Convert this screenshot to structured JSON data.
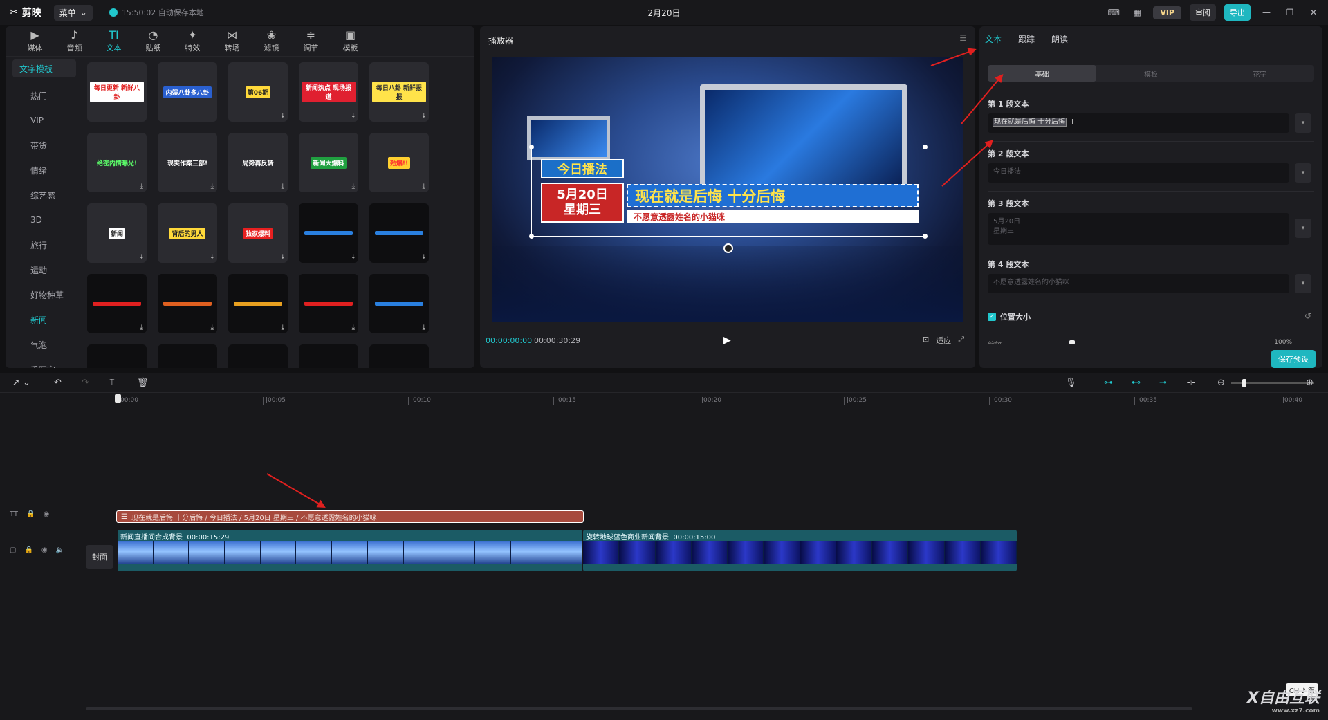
{
  "app": {
    "name": "剪映",
    "menu_label": "菜单",
    "save_status": "15:50:02 自动保存本地",
    "project_title": "2月20日"
  },
  "titlebar": {
    "vip": "VIP",
    "review": "审阅",
    "export": "导出"
  },
  "toolbar": [
    "媒体",
    "音频",
    "文本",
    "贴纸",
    "特效",
    "转场",
    "滤镜",
    "调节",
    "模板"
  ],
  "toolbar_icons": [
    "▶",
    "♪",
    "TI",
    "◔",
    "✦",
    "⋈",
    "❀",
    "≑",
    "▣"
  ],
  "categories": [
    "文字模板",
    "热门",
    "VIP",
    "带货",
    "情绪",
    "综艺感",
    "3D",
    "旅行",
    "运动",
    "好物种草",
    "新闻",
    "气泡",
    "手写字"
  ],
  "tiles": [
    {
      "t": "每日更新 新鲜八卦",
      "c": "#e02020",
      "bg": "#fff"
    },
    {
      "t": "内娱八卦多八卦",
      "c": "#fff",
      "bg": "#2a60d0"
    },
    {
      "t": "第06期",
      "c": "#222",
      "bg": "#ffd93a"
    },
    {
      "t": "新闻热点 现场报道",
      "c": "#fff",
      "bg": "#e02030"
    },
    {
      "t": "每日八卦 新鲜报报",
      "c": "#333",
      "bg": "#ffe34a"
    },
    {
      "t": "绝密内情曝光!",
      "c": "#5cff6a",
      "bg": "transparent"
    },
    {
      "t": "现实作案三部!",
      "c": "#fff",
      "bg": "transparent"
    },
    {
      "t": "局势再反转",
      "c": "#fff",
      "bg": "transparent"
    },
    {
      "t": "新闻大爆料",
      "c": "#fff",
      "bg": "#20a040"
    },
    {
      "t": "劲爆!!",
      "c": "#ff3030",
      "bg": "#ffd030"
    },
    {
      "t": "新闻",
      "c": "#333",
      "bg": "#fff"
    },
    {
      "t": "背后的男人",
      "c": "#222",
      "bg": "#ffd93a"
    },
    {
      "t": "独家爆料",
      "c": "#fff",
      "bg": "#e82020"
    },
    {
      "t": "",
      "c": "#fff",
      "bg": "#2a80e0"
    },
    {
      "t": "",
      "c": "#fff",
      "bg": "#2a80e0"
    },
    {
      "t": "",
      "c": "#fff",
      "bg": "#e02020"
    },
    {
      "t": "",
      "c": "#fff",
      "bg": "#e06020"
    },
    {
      "t": "",
      "c": "#fff",
      "bg": "#e8a020"
    },
    {
      "t": "",
      "c": "#fff",
      "bg": "#e02020"
    },
    {
      "t": "",
      "c": "#fff",
      "bg": "#2a80e0"
    },
    {
      "t": "",
      "c": "#fff",
      "bg": "#1a4ad0"
    },
    {
      "t": "",
      "c": "#fff",
      "bg": "#2a6ae0"
    },
    {
      "t": "",
      "c": "#222",
      "bg": "#ffd93a"
    },
    {
      "t": "",
      "c": "#fff",
      "bg": "#20a0a0"
    },
    {
      "t": "",
      "c": "#222",
      "bg": "#fff"
    }
  ],
  "player": {
    "title": "播放器",
    "tag": "今日播法",
    "date1": "5月20日",
    "date2": "星期三",
    "headline": "现在就是后悔 十分后悔",
    "subline": "不愿意透露姓名的小猫咪",
    "timecode": "00:00:00:00",
    "duration": "00:00:30:29",
    "ratio": "适应"
  },
  "right": {
    "tabs": [
      "文本",
      "跟踪",
      "朗读"
    ],
    "segments": [
      "基础",
      "模板",
      "花字"
    ],
    "fields": [
      {
        "label": "第 1 段文本",
        "value": "现在就是后悔 十分后悔"
      },
      {
        "label": "第 2 段文本",
        "value": "今日播法"
      },
      {
        "label": "第 3 段文本",
        "value": "5月20日",
        "value2": "星期三"
      },
      {
        "label": "第 4 段文本",
        "value": "不愿意透露姓名的小猫咪"
      }
    ],
    "position_size": "位置大小",
    "scale_label": "缩放",
    "scale_value": "100%",
    "save_preset": "保存预设"
  },
  "timeline": {
    "ticks": [
      "00:00",
      "|00:05",
      "|00:10",
      "|00:15",
      "|00:20",
      "|00:25",
      "|00:30",
      "|00:35",
      "|00:40"
    ],
    "text_clip": "现在就是后悔 十分后悔 / 今日播法 / 5月20日 星期三 / 不愿意透露姓名的小猫咪",
    "cover": "封面",
    "clip1_name": "新闻直播间合成背景",
    "clip1_dur": "00:00:15:29",
    "clip2_name": "旋转地球蓝色商业新闻背景",
    "clip2_dur": "00:00:15:00"
  },
  "watermark": {
    "brand": "X自由互联",
    "url": "www.xz7.com"
  },
  "ime": "CH ♪ 简"
}
